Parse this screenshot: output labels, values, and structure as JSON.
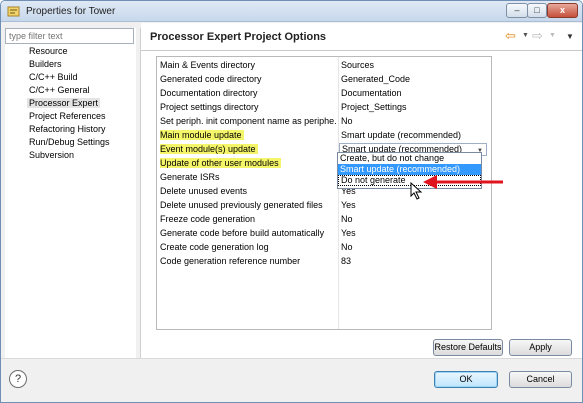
{
  "window": {
    "title": "Properties for Tower",
    "minimize": "–",
    "maximize": "□",
    "close": "x"
  },
  "filter": {
    "placeholder": "type filter text"
  },
  "tree": [
    {
      "label": "Resource"
    },
    {
      "label": "Builders"
    },
    {
      "label": "C/C++ Build"
    },
    {
      "label": "C/C++ General"
    },
    {
      "label": "Processor Expert",
      "selected": true
    },
    {
      "label": "Project References"
    },
    {
      "label": "Refactoring History"
    },
    {
      "label": "Run/Debug Settings"
    },
    {
      "label": "Subversion"
    }
  ],
  "page": {
    "title": "Processor Expert Project Options",
    "nav_back_icon": "back-arrow-icon",
    "nav_forward_icon": "forward-arrow-icon",
    "menu_icon": "view-menu-icon"
  },
  "options": [
    {
      "name": "Main & Events directory",
      "value": "Sources"
    },
    {
      "name": "Generated code directory",
      "value": "Generated_Code"
    },
    {
      "name": "Documentation directory",
      "value": "Documentation"
    },
    {
      "name": "Project settings directory",
      "value": "Project_Settings"
    },
    {
      "name": "Set periph. init component name as periphe...",
      "value": "No"
    },
    {
      "name": "Main module update",
      "value": "Smart update (recommended)",
      "highlighted": true
    },
    {
      "name": "Event module(s) update",
      "value": "Smart update (recommended)",
      "highlighted": true,
      "editing": true
    },
    {
      "name": "Update of other user modules",
      "value": "",
      "highlighted": true
    },
    {
      "name": "Generate ISRs",
      "value": ""
    },
    {
      "name": "Delete unused events",
      "value": "Yes"
    },
    {
      "name": "Delete unused previously generated files",
      "value": "Yes"
    },
    {
      "name": "Freeze code generation",
      "value": "No"
    },
    {
      "name": "Generate code before build automatically",
      "value": "Yes"
    },
    {
      "name": "Create code generation log",
      "value": "No"
    },
    {
      "name": "Code generation reference number",
      "value": "83"
    }
  ],
  "dropdown": {
    "options": [
      {
        "label": "Create, but do not change"
      },
      {
        "label": "Smart update (recommended)",
        "selected": true
      },
      {
        "label": "Do not generate",
        "focused": true
      }
    ]
  },
  "colors": {
    "highlight": "#f5f56a",
    "selection": "#3399ff",
    "annotation_arrow": "#e0141e"
  },
  "buttons": {
    "restore_defaults": "Restore Defaults",
    "apply": "Apply",
    "ok": "OK",
    "cancel": "Cancel",
    "help": "?"
  }
}
